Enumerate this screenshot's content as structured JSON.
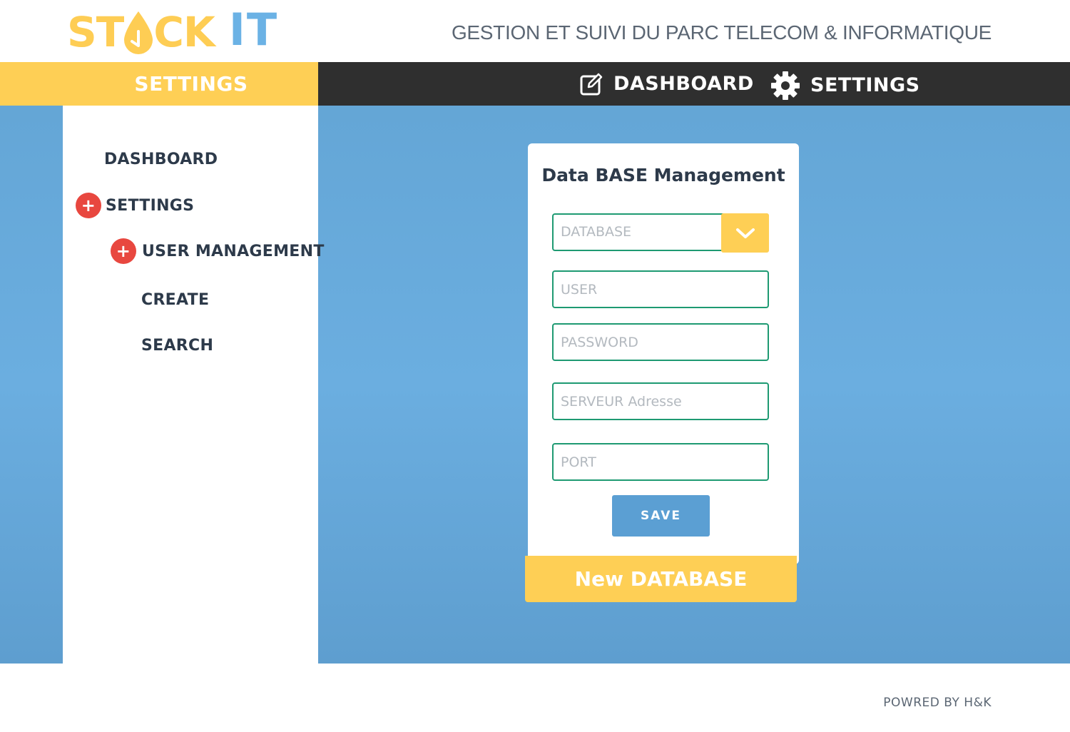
{
  "header": {
    "logo_part1": "ST",
    "logo_part2": "CK",
    "logo_part3": "IT",
    "tagline": "GESTION ET SUIVI DU PARC TELECOM & INFORMATIQUE"
  },
  "nav": {
    "section_title": "SETTINGS",
    "dashboard_label": "DASHBOARD",
    "settings_label": "SETTINGS",
    "dashboard_icon": "edit-icon",
    "settings_icon": "gear-icon"
  },
  "sidebar": {
    "items": [
      {
        "label": "DASHBOARD",
        "expandable": false
      },
      {
        "label": "SETTINGS",
        "expandable": true
      },
      {
        "label": "USER MANAGEMENT",
        "expandable": true
      },
      {
        "label": "CREATE",
        "expandable": false
      },
      {
        "label": "SEARCH",
        "expandable": false
      }
    ]
  },
  "card": {
    "title": "Data BASE Management",
    "database_select": {
      "placeholder": "DATABASE",
      "icon": "chevron-down-icon"
    },
    "user_placeholder": "USER",
    "password_placeholder": "PASSWORD",
    "server_placeholder": "SERVEUR Adresse",
    "port_placeholder": "PORT",
    "save_label": "SAVE",
    "new_database_label": "New DATABASE"
  },
  "footer": {
    "powered_by": "POWRED BY H&K"
  },
  "colors": {
    "accent_yellow": "#fecf55",
    "accent_blue": "#6bb2e5",
    "nav_dark": "#2f2f2f",
    "field_border": "#1e9a72",
    "plus_red": "#e8473f"
  }
}
